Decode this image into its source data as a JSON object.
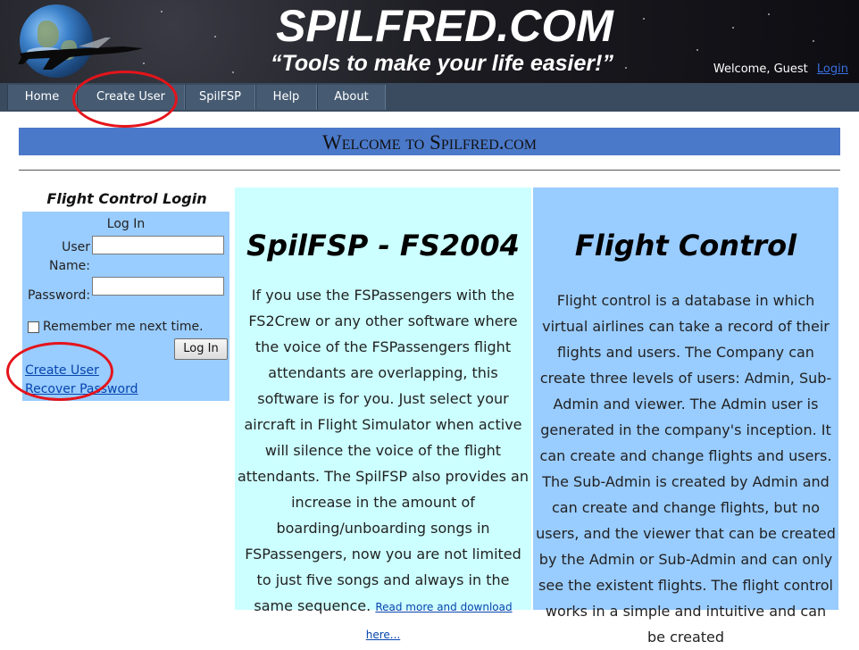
{
  "header": {
    "site_title": "SPILFRED.COM",
    "tagline": "“Tools to make your life easier!”",
    "welcome_text": "Welcome, Guest",
    "login_link": "Login"
  },
  "nav": {
    "items": [
      {
        "label": "Home"
      },
      {
        "label": "Create User"
      },
      {
        "label": "SpilFSP"
      },
      {
        "label": "Help"
      },
      {
        "label": "About"
      }
    ]
  },
  "banner": {
    "title": "Welcome to Spilfred.com"
  },
  "login": {
    "title": "Flight Control Login",
    "heading": "Log In",
    "user_label": "User Name:",
    "password_label": "Password:",
    "remember_label": "Remember me next time.",
    "button_label": "Log In",
    "create_user_link": "Create User",
    "recover_password_link": "Recover Password"
  },
  "spilfsp": {
    "title": "SpilFSP - FS2004",
    "body": "If you use the FSPassengers with the FS2Crew or any other software where the voice of the FSPassengers flight attendants are overlapping, this software is for you. Just select your aircraft in Flight Simulator when active will silence the voice of the flight attendants. The SpilFSP also provides an increase in the amount of boarding/unboarding songs in FSPassengers, now you are not limited to just five songs and always in the same sequence.",
    "link": "Read more and download here..."
  },
  "flight_control": {
    "title": "Flight Control",
    "body": "Flight control is a database in which virtual airlines can take a record of their flights and users. The Company can create three levels of users: Admin, Sub-Admin and viewer. The Admin user is generated in the company's inception. It can create and change flights and users. The Sub-Admin is created by Admin and can create and change flights, but no users, and the viewer that can be created by the Admin or Sub-Admin and can only see the existent flights. The flight control works in a simple and intuitive and can be created"
  },
  "colors": {
    "nav_bg": "#3a4b5f",
    "banner_bg": "#4b79c9",
    "login_bg": "#99ccff",
    "col1_bg": "#ccffff",
    "col2_bg": "#99ccff",
    "annotation": "#e4141b"
  },
  "icons": [
    "globe-icon",
    "airplane-icon"
  ]
}
